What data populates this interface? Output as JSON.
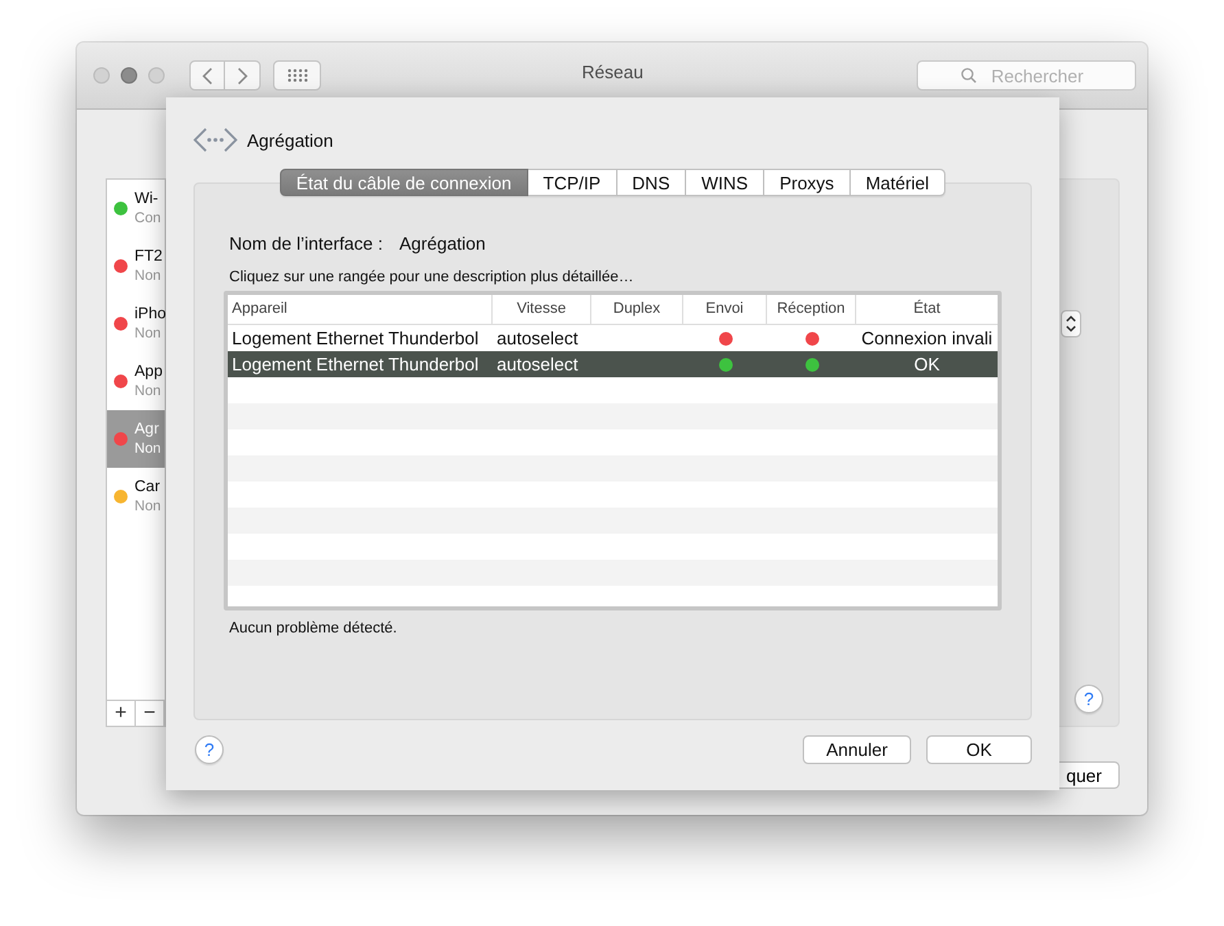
{
  "window": {
    "title": "Réseau",
    "search": {
      "placeholder": "Rechercher"
    },
    "help_button": "?",
    "apply_button": "quer"
  },
  "sidebar": {
    "items": [
      {
        "name": "Wi-",
        "status": "Con",
        "color": "#3dc23f",
        "selected": false
      },
      {
        "name": "FT2",
        "status": "Non",
        "color": "#f0464a",
        "selected": false
      },
      {
        "name": "iPho",
        "status": "Non",
        "color": "#f0464a",
        "selected": false
      },
      {
        "name": "App",
        "status": "Non",
        "color": "#f0464a",
        "selected": false
      },
      {
        "name": "Agr",
        "status": "Non",
        "color": "#f0464a",
        "selected": true
      },
      {
        "name": "Car",
        "status": "Non",
        "color": "#f7b531",
        "selected": false
      }
    ],
    "buttons": [
      "+",
      "−"
    ]
  },
  "sheet": {
    "title": "Agrégation",
    "tabs": [
      {
        "label": "État du câble de connexion",
        "selected": true
      },
      {
        "label": "TCP/IP",
        "selected": false
      },
      {
        "label": "DNS",
        "selected": false
      },
      {
        "label": "WINS",
        "selected": false
      },
      {
        "label": "Proxys",
        "selected": false
      },
      {
        "label": "Matériel",
        "selected": false
      }
    ],
    "interface_label": "Nom de l’interface :",
    "interface_name": "Agrégation",
    "hint": "Cliquez sur une rangée pour une description plus détaillée…",
    "table": {
      "columns": [
        "Appareil",
        "Vitesse",
        "Duplex",
        "Envoi",
        "Réception",
        "État"
      ],
      "rows": [
        {
          "device": "Logement Ethernet Thunderbol",
          "speed": "autoselect",
          "send": {
            "color": "#f0464a"
          },
          "receive": {
            "color": "#f0464a"
          },
          "state": "Connexion invali",
          "selected": false
        },
        {
          "device": "Logement Ethernet Thunderbol",
          "speed": "autoselect",
          "send": {
            "color": "#3dc23f"
          },
          "receive": {
            "color": "#3dc23f"
          },
          "state": "OK",
          "selected": true
        }
      ]
    },
    "status_message": "Aucun problème détecté.",
    "help_button": "?",
    "cancel_button": "Annuler",
    "ok_button": "OK"
  }
}
